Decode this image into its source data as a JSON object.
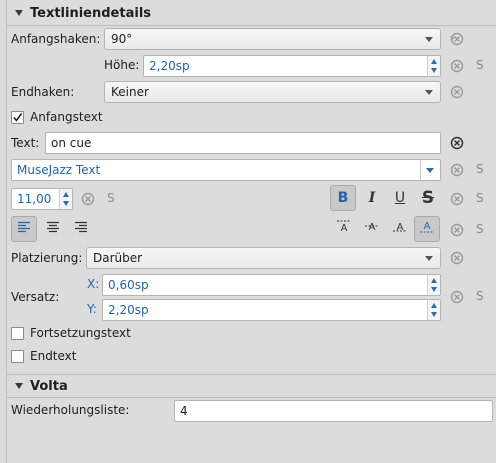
{
  "sections": {
    "textline": {
      "title": "Textliniendetails"
    },
    "volta": {
      "title": "Volta"
    }
  },
  "fields": {
    "begin_hook_label": "Anfangshaken:",
    "begin_hook_value": "90°",
    "height_label": "Höhe:",
    "height_value": "2,20sp",
    "end_hook_label": "Endhaken:",
    "end_hook_value": "Keiner",
    "begin_text_label": "Anfangstext",
    "begin_text_checked": true,
    "text_label": "Text:",
    "text_value": "on cue",
    "font_value": "MuseJazz Text",
    "font_size_value": "11,00",
    "placement_label": "Platzierung:",
    "placement_value": "Darüber",
    "offset_label": "Versatz:",
    "offset_x_label": "X:",
    "offset_x_value": "0,60sp",
    "offset_y_label": "Y:",
    "offset_y_value": "2,20sp",
    "continue_text_label": "Fortsetzungstext",
    "continue_text_checked": false,
    "end_text_label": "Endtext",
    "end_text_checked": false,
    "repeat_list_label": "Wiederholungsliste:",
    "repeat_list_value": "4"
  },
  "format": {
    "bold": "B",
    "italic": "I",
    "underline": "U",
    "strike": "S",
    "bold_on": true,
    "align_left_on": true,
    "frame_none_on": true
  },
  "style_button": "S",
  "colors": {
    "accent": "#2265ad",
    "panel": "#dcdcdc"
  }
}
